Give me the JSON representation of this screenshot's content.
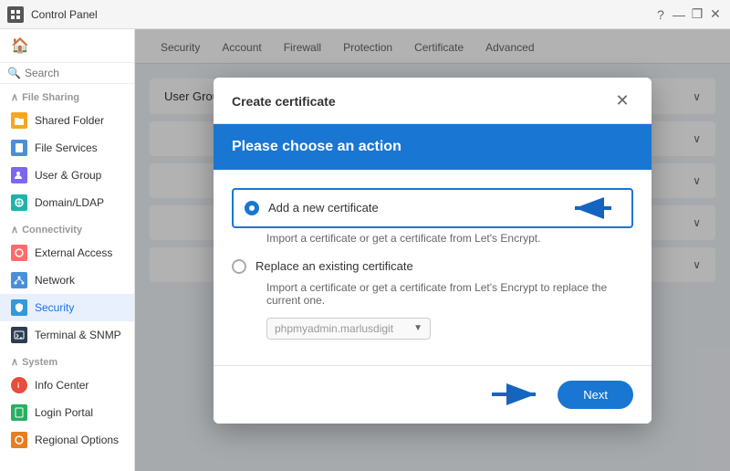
{
  "titleBar": {
    "title": "Control Panel",
    "buttons": [
      "?",
      "—",
      "❐",
      "✕"
    ]
  },
  "sidebar": {
    "searchPlaceholder": "Search",
    "sections": [
      {
        "label": "File Sharing",
        "items": [
          {
            "id": "shared-folder",
            "label": "Shared Folder",
            "iconColor": "#f5a623"
          },
          {
            "id": "file-services",
            "label": "File Services",
            "iconColor": "#4a90d9"
          },
          {
            "id": "user-group",
            "label": "User & Group",
            "iconColor": "#7b68ee"
          },
          {
            "id": "domain-ldap",
            "label": "Domain/LDAP",
            "iconColor": "#20b2aa"
          }
        ]
      },
      {
        "label": "Connectivity",
        "items": [
          {
            "id": "external-access",
            "label": "External Access",
            "iconColor": "#ff6b6b"
          },
          {
            "id": "network",
            "label": "Network",
            "iconColor": "#4a90d9"
          },
          {
            "id": "security",
            "label": "Security",
            "iconColor": "#3498db",
            "active": true
          },
          {
            "id": "terminal-snmp",
            "label": "Terminal & SNMP",
            "iconColor": "#2c3e50"
          }
        ]
      },
      {
        "label": "System",
        "items": [
          {
            "id": "info-center",
            "label": "Info Center",
            "iconColor": "#e74c3c"
          },
          {
            "id": "login-portal",
            "label": "Login Portal",
            "iconColor": "#27ae60"
          },
          {
            "id": "regional-options",
            "label": "Regional Options",
            "iconColor": "#e67e22"
          }
        ]
      }
    ]
  },
  "contentTabs": [
    "Security",
    "Account",
    "Firewall",
    "Protection",
    "Certificate",
    "Advanced"
  ],
  "sections": [
    {
      "id": "section1",
      "title": "User Group"
    },
    {
      "id": "section2",
      "title": ""
    },
    {
      "id": "section3",
      "title": ""
    },
    {
      "id": "section4",
      "title": ""
    },
    {
      "id": "section5",
      "title": ""
    }
  ],
  "modal": {
    "headerTitle": "Create certificate",
    "actionTitle": "Please choose an action",
    "option1": {
      "label": "Add a new certificate",
      "description": "Import a certificate or get a certificate from Let's Encrypt.",
      "selected": true
    },
    "option2": {
      "label": "Replace an existing certificate",
      "description": "Import a certificate or get a certificate from Let's Encrypt to replace the current one.",
      "selected": false
    },
    "dropdown": {
      "value": "phpmyadmin.marlusdigit",
      "placeholder": "phpmyadmin.marlusdigit ▼"
    },
    "nextButton": "Next"
  }
}
